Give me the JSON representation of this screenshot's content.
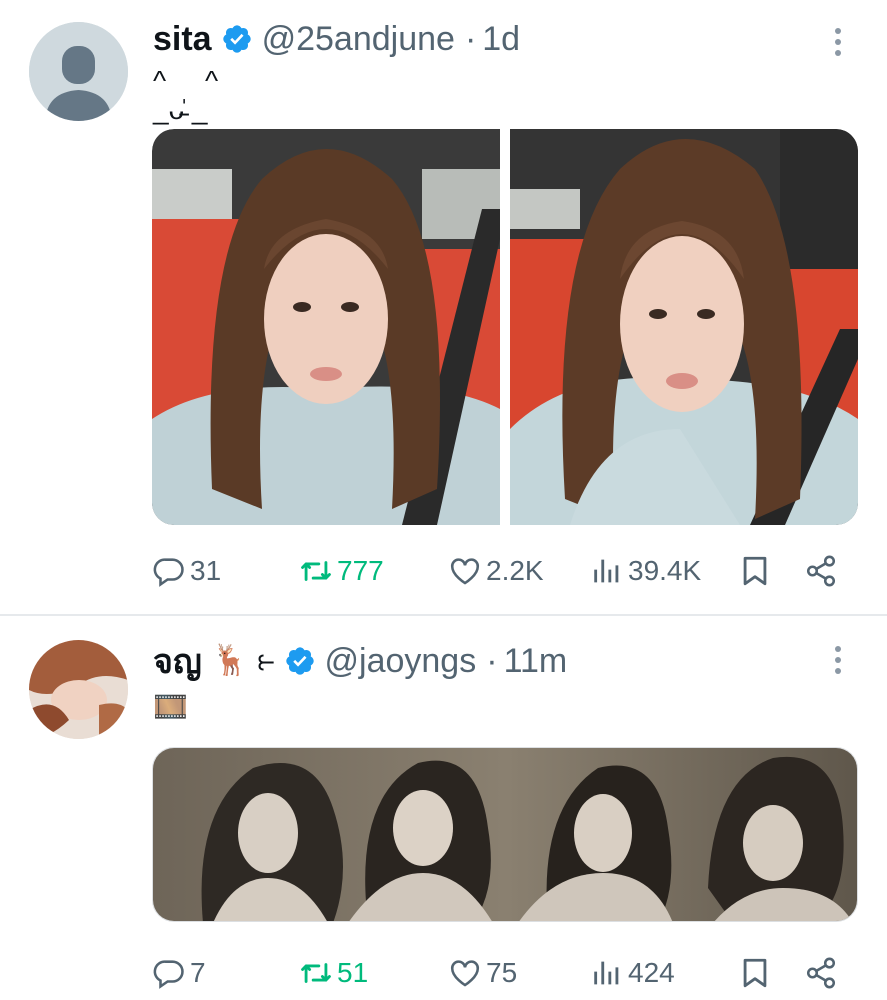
{
  "tweets": [
    {
      "name": "sita",
      "handle": "@25andjune",
      "dot": "·",
      "time": "1d",
      "text": "^     ^\n_ᴗ̵̍ _",
      "counts": {
        "replies": "31",
        "retweets": "777",
        "likes": "2.2K",
        "views": "39.4K"
      }
    },
    {
      "name": "จญ",
      "name_emoji": "🦌 ⥼",
      "handle": "@jaoyngs",
      "dot": "·",
      "time": "11m",
      "text": "🎞️",
      "counts": {
        "replies": "7",
        "retweets": "51",
        "likes": "75",
        "views": "424"
      }
    }
  ],
  "colors": {
    "verified": "#1d9bf0",
    "retweet": "#00ba7c",
    "secondary_text": "#536471",
    "divider": "#e6e9ec"
  },
  "icons": [
    "reply-icon",
    "retweet-icon",
    "like-icon",
    "views-icon",
    "bookmark-icon",
    "share-icon",
    "more-icon",
    "verified-icon"
  ]
}
